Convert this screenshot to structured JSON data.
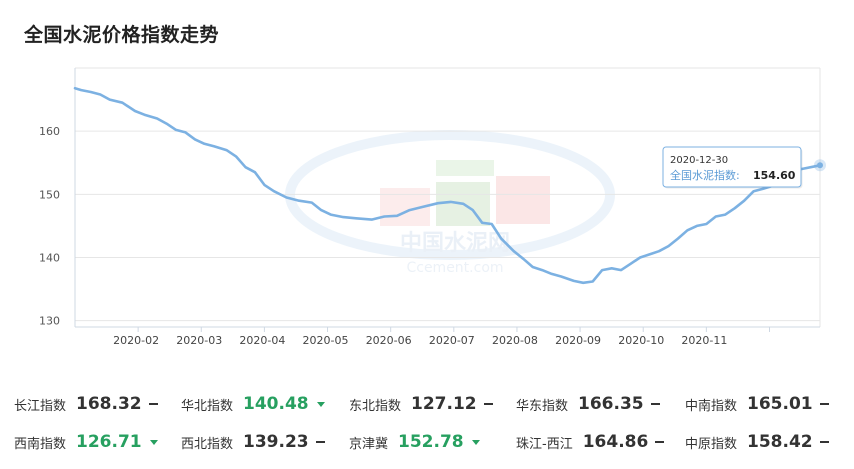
{
  "header": {
    "title": "全国水泥价格指数走势"
  },
  "colors": {
    "line": "#7cb1e2",
    "down": "#27a060",
    "grid": "#e6e6e6",
    "tooltip_label": "#5b9bd5"
  },
  "watermark": {
    "logo_text": "中国水泥网",
    "logo_url_text": "Ccement.com"
  },
  "chart_data": {
    "type": "line",
    "y_ticks": [
      130,
      140,
      150,
      160
    ],
    "ylim": [
      129,
      170
    ],
    "x_tick_labels": [
      "2020-02",
      "2020-03",
      "2020-04",
      "2020-05",
      "2020-06",
      "2020-07",
      "2020-08",
      "2020-09",
      "2020-10",
      "2020-11"
    ],
    "x_tick_months": [
      1,
      2,
      3,
      4,
      5,
      6,
      7,
      8,
      9,
      10
    ],
    "x_range_months": [
      0,
      11.8
    ],
    "grid": "horizontal",
    "series": [
      {
        "values_by_month": [
          [
            0.0,
            166.8
          ],
          [
            0.1,
            166.5
          ],
          [
            0.25,
            166.2
          ],
          [
            0.4,
            165.8
          ],
          [
            0.55,
            165.0
          ],
          [
            0.75,
            164.5
          ],
          [
            0.95,
            163.2
          ],
          [
            1.1,
            162.6
          ],
          [
            1.3,
            162.0
          ],
          [
            1.45,
            161.2
          ],
          [
            1.6,
            160.2
          ],
          [
            1.75,
            159.8
          ],
          [
            1.9,
            158.7
          ],
          [
            2.05,
            158.0
          ],
          [
            2.2,
            157.6
          ],
          [
            2.4,
            157.0
          ],
          [
            2.55,
            156.0
          ],
          [
            2.7,
            154.3
          ],
          [
            2.85,
            153.5
          ],
          [
            3.0,
            151.5
          ],
          [
            3.15,
            150.5
          ],
          [
            3.35,
            149.5
          ],
          [
            3.55,
            149.0
          ],
          [
            3.75,
            148.7
          ],
          [
            3.9,
            147.5
          ],
          [
            4.05,
            146.8
          ],
          [
            4.25,
            146.4
          ],
          [
            4.45,
            146.2
          ],
          [
            4.7,
            146.0
          ],
          [
            4.9,
            146.5
          ],
          [
            5.1,
            146.6
          ],
          [
            5.3,
            147.5
          ],
          [
            5.5,
            148.0
          ],
          [
            5.75,
            148.6
          ],
          [
            5.95,
            148.8
          ],
          [
            6.15,
            148.5
          ],
          [
            6.3,
            147.5
          ],
          [
            6.45,
            145.5
          ],
          [
            6.6,
            145.3
          ],
          [
            6.75,
            143.0
          ],
          [
            6.95,
            141.0
          ],
          [
            7.1,
            139.8
          ],
          [
            7.25,
            138.5
          ],
          [
            7.4,
            138.0
          ],
          [
            7.55,
            137.4
          ],
          [
            7.7,
            137.0
          ],
          [
            7.9,
            136.3
          ],
          [
            8.05,
            136.0
          ],
          [
            8.2,
            136.2
          ],
          [
            8.35,
            138.0
          ],
          [
            8.5,
            138.3
          ],
          [
            8.65,
            138.0
          ],
          [
            8.8,
            139.0
          ],
          [
            8.95,
            140.0
          ],
          [
            9.1,
            140.5
          ],
          [
            9.25,
            141.0
          ],
          [
            9.4,
            141.8
          ],
          [
            9.55,
            143.0
          ],
          [
            9.7,
            144.3
          ],
          [
            9.85,
            145.0
          ],
          [
            10.0,
            145.3
          ],
          [
            10.15,
            146.5
          ],
          [
            10.3,
            146.8
          ],
          [
            10.45,
            147.8
          ],
          [
            10.6,
            149.0
          ],
          [
            10.75,
            150.5
          ],
          [
            10.9,
            150.9
          ],
          [
            11.1,
            151.5
          ],
          [
            11.3,
            153.0
          ],
          [
            11.5,
            154.0
          ],
          [
            11.8,
            154.6
          ]
        ]
      }
    ],
    "tooltip": {
      "date": "2020-12-30",
      "series_label": "全国水泥指数:",
      "value": "154.60"
    }
  },
  "indices": [
    [
      {
        "name": "长江指数",
        "value": "168.32",
        "trend": "flat"
      },
      {
        "name": "华北指数",
        "value": "140.48",
        "trend": "down"
      },
      {
        "name": "东北指数",
        "value": "127.12",
        "trend": "flat"
      },
      {
        "name": "华东指数",
        "value": "166.35",
        "trend": "flat"
      },
      {
        "name": "中南指数",
        "value": "165.01",
        "trend": "flat"
      }
    ],
    [
      {
        "name": "西南指数",
        "value": "126.71",
        "trend": "down"
      },
      {
        "name": "西北指数",
        "value": "139.23",
        "trend": "flat"
      },
      {
        "name": "京津冀",
        "value": "152.78",
        "trend": "down"
      },
      {
        "name": "珠江-西江",
        "value": "164.86",
        "trend": "flat"
      },
      {
        "name": "中原指数",
        "value": "158.42",
        "trend": "flat"
      }
    ]
  ]
}
